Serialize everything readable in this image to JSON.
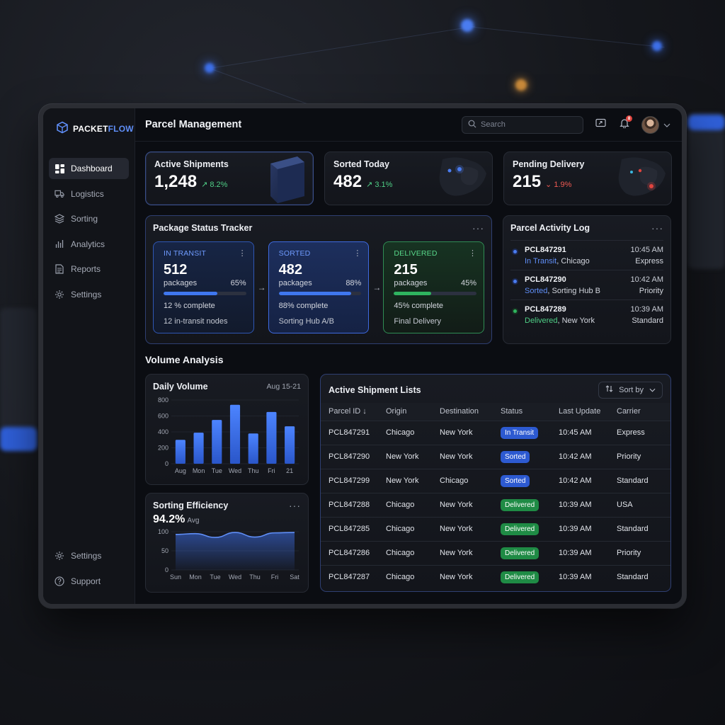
{
  "colors": {
    "accent": "#5f8ef7",
    "blue_status": "#2d5ad1",
    "green_status": "#1f8b45",
    "up": "#4fcf86",
    "down": "#ef5a52"
  },
  "brand": {
    "name_part1": "PACKET",
    "name_part2": "FLOW",
    "icon": "cube-icon"
  },
  "sidebar": {
    "items": [
      {
        "label": "Dashboard",
        "icon": "grid-icon",
        "active": true
      },
      {
        "label": "Logistics",
        "icon": "truck-icon"
      },
      {
        "label": "Sorting",
        "icon": "layers-icon"
      },
      {
        "label": "Analytics",
        "icon": "bar-chart-icon"
      },
      {
        "label": "Reports",
        "icon": "document-icon"
      },
      {
        "label": "Settings",
        "icon": "gear-icon"
      }
    ],
    "bottom_items": [
      {
        "label": "Settings",
        "icon": "gear-icon"
      },
      {
        "label": "Support",
        "icon": "help-circle-icon"
      }
    ]
  },
  "header": {
    "title": "Parcel Management",
    "search_placeholder": "Search",
    "notification_count": "8"
  },
  "kpis": [
    {
      "label": "Active Shipments",
      "value": "1,248",
      "delta": "↗ 8.2%",
      "direction": "up"
    },
    {
      "label": "Sorted Today",
      "value": "482",
      "delta": "↗ 3.1%",
      "direction": "up"
    },
    {
      "label": "Pending Delivery",
      "value": "215",
      "delta": "⌄ 1.9%",
      "direction": "down"
    }
  ],
  "tracker": {
    "title": "Package Status Tracker",
    "stages": [
      {
        "name": "IN TRANSIT",
        "count": "512",
        "unit": "packages",
        "percent_label": "65%",
        "progress": 0.65,
        "complete_label": "12 % complete",
        "detail": "12 in-transit nodes"
      },
      {
        "name": "SORTED",
        "count": "482",
        "unit": "packages",
        "percent_label": "88%",
        "progress": 0.88,
        "complete_label": "88% complete",
        "detail": "Sorting Hub A/B"
      },
      {
        "name": "DELIVERED",
        "count": "215",
        "unit": "packages",
        "percent_label": "45%",
        "progress": 0.45,
        "complete_label": "45% complete",
        "detail": "Final Delivery"
      }
    ]
  },
  "activity": {
    "title": "Parcel Activity Log",
    "items": [
      {
        "id": "PCL847291",
        "time": "10:45 AM",
        "status": "In Transit",
        "location": ", Chicago",
        "carrier": "Express",
        "tone": "blue"
      },
      {
        "id": "PCL847290",
        "time": "10:42 AM",
        "status": "Sorted",
        "location": ", Sorting Hub B",
        "carrier": "Priority",
        "tone": "blue"
      },
      {
        "id": "PCL847289",
        "time": "10:39 AM",
        "status": "Delivered",
        "location": ", New York",
        "carrier": "Standard",
        "tone": "green"
      }
    ]
  },
  "volume": {
    "section_title": "Volume Analysis",
    "daily_title": "Daily Volume",
    "daily_range": "Aug 15-21",
    "efficiency_title": "Sorting Efficiency",
    "efficiency_value": "94.2%",
    "efficiency_suffix": "Avg"
  },
  "chart_data": [
    {
      "type": "bar",
      "title": "Daily Volume",
      "categories": [
        "Aug",
        "Mon",
        "Tue",
        "Wed",
        "Thu",
        "Fri",
        "21"
      ],
      "values": [
        300,
        390,
        550,
        740,
        380,
        650,
        470
      ],
      "ylim": [
        0,
        800
      ],
      "yticks": [
        0,
        200,
        400,
        600,
        800
      ]
    },
    {
      "type": "area",
      "title": "Sorting Efficiency",
      "categories": [
        "Sun",
        "Mon",
        "Tue",
        "Wed",
        "Thu",
        "Fri",
        "Sat"
      ],
      "values": [
        93,
        95,
        85,
        98,
        86,
        97,
        98
      ],
      "ylim": [
        0,
        100
      ],
      "yticks": [
        0,
        50,
        100
      ]
    }
  ],
  "shipments": {
    "title": "Active Shipment Lists",
    "sort_label": "Sort by",
    "columns": [
      "Parcel ID ↓",
      "Origin",
      "Destination",
      "Status",
      "Last Update",
      "Carrier"
    ],
    "rows": [
      {
        "id": "PCL847291",
        "origin": "Chicago",
        "destination": "New York",
        "status": "In Transit",
        "kind": "transit",
        "updated": "10:45 AM",
        "carrier": "Express"
      },
      {
        "id": "PCL847290",
        "origin": "New York",
        "destination": "New York",
        "status": "Sorted",
        "kind": "sorted",
        "updated": "10:42 AM",
        "carrier": "Priority"
      },
      {
        "id": "PCL847299",
        "origin": "New York",
        "destination": "Chicago",
        "status": "Sorted",
        "kind": "sorted",
        "updated": "10:42 AM",
        "carrier": "Standard"
      },
      {
        "id": "PCL847288",
        "origin": "Chicago",
        "destination": "New York",
        "status": "Delivered",
        "kind": "delivered",
        "updated": "10:39 AM",
        "carrier": "USA"
      },
      {
        "id": "PCL847285",
        "origin": "Chicago",
        "destination": "New York",
        "status": "Delivered",
        "kind": "delivered",
        "updated": "10:39 AM",
        "carrier": "Standard"
      },
      {
        "id": "PCL847286",
        "origin": "Chicago",
        "destination": "New York",
        "status": "Delivered",
        "kind": "delivered",
        "updated": "10:39 AM",
        "carrier": "Priority"
      },
      {
        "id": "PCL847287",
        "origin": "Chicago",
        "destination": "New York",
        "status": "Delivered",
        "kind": "delivered",
        "updated": "10:39 AM",
        "carrier": "Standard"
      }
    ]
  }
}
